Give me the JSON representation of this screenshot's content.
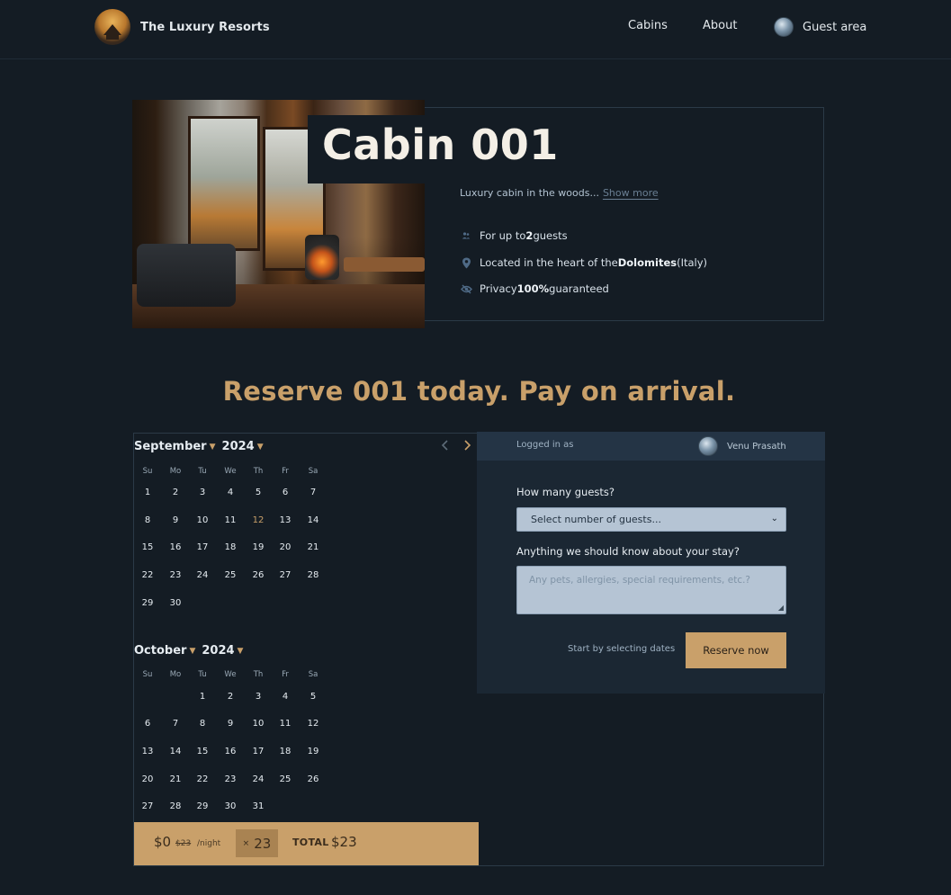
{
  "header": {
    "brand": "The Luxury Resorts",
    "nav": [
      "Cabins",
      "About"
    ],
    "guest_area": "Guest area"
  },
  "cabin": {
    "title": "Cabin 001",
    "description": "Luxury cabin in the woods...",
    "show_more": "Show more",
    "features": {
      "guests_prefix": "For up to ",
      "guests_count": "2",
      "guests_suffix": " guests",
      "location_prefix": "Located in the heart of the ",
      "location_bold": "Dolomites",
      "location_suffix": " (Italy)",
      "privacy_prefix": "Privacy ",
      "privacy_bold": "100%",
      "privacy_suffix": " guaranteed"
    }
  },
  "reserve_heading": "Reserve 001 today. Pay on arrival.",
  "calendar": {
    "months": [
      {
        "name": "September",
        "year": "2024"
      },
      {
        "name": "October",
        "year": "2024"
      }
    ],
    "weekdays": [
      "Su",
      "Mo",
      "Tu",
      "We",
      "Th",
      "Fr",
      "Sa"
    ],
    "today": "12",
    "prev_icon": "chevron-left-icon",
    "next_icon": "chevron-right-icon"
  },
  "panel": {
    "logged_in_as": "Logged in as",
    "user_name": "Venu Prasath",
    "guests_label": "How many guests?",
    "guests_select": "Select number of guests...",
    "notes_label": "Anything we should know about your stay?",
    "notes_placeholder": "Any pets, allergies, special requirements, etc.?",
    "start_text": "Start by selecting dates",
    "reserve_button": "Reserve now"
  },
  "price": {
    "current": "$0",
    "original": "$23",
    "per_night": "/night",
    "nights_prefix": "×",
    "nights": "23",
    "total_label": "TOTAL",
    "total": "$23"
  },
  "colors": {
    "background": "#141c24",
    "accent": "#c9a06a",
    "panel": "#1b2733",
    "input": "#b5c4d4"
  }
}
